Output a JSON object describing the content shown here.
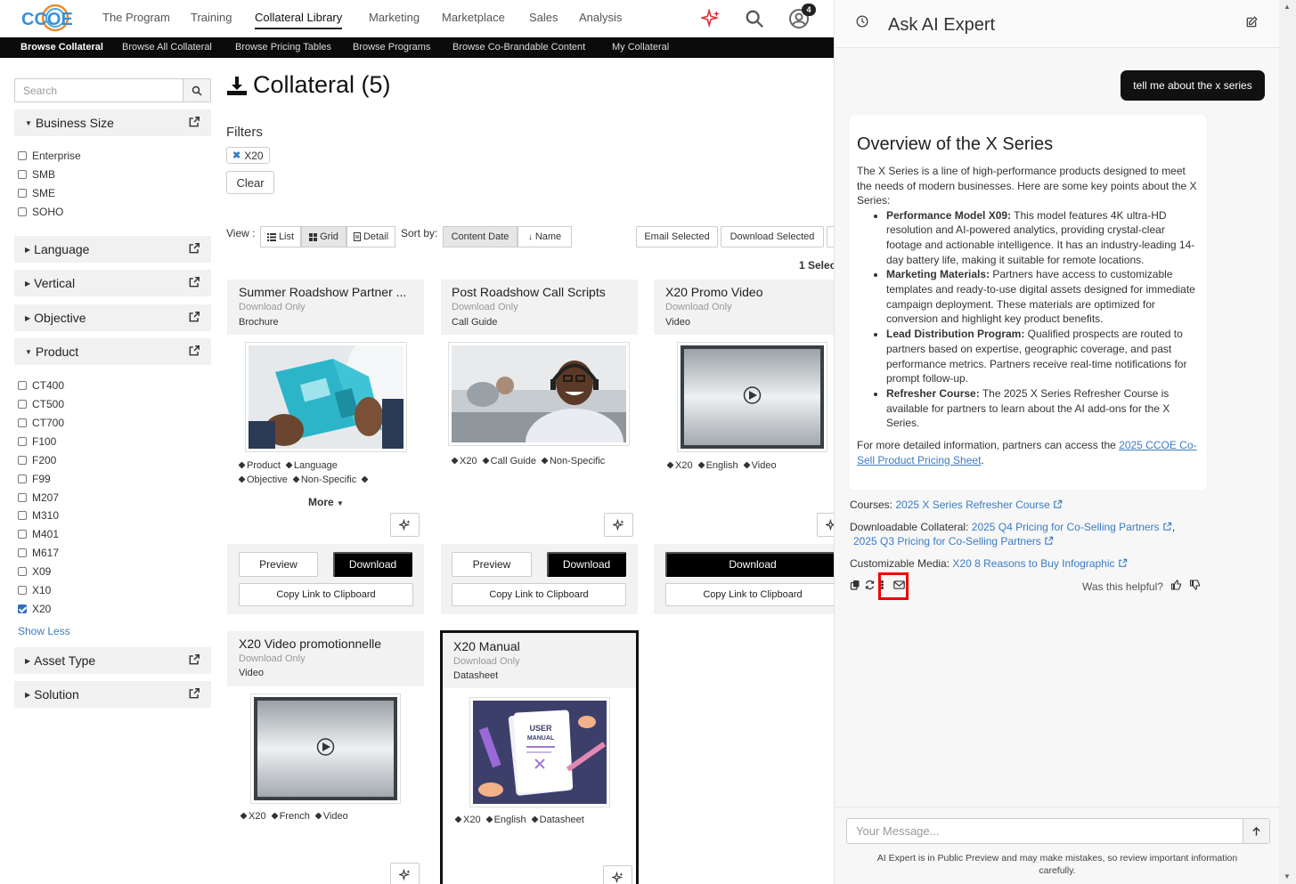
{
  "brand": {
    "logo_text": "CCOE"
  },
  "topnav": {
    "items": [
      {
        "label": "The Program"
      },
      {
        "label": "Training"
      },
      {
        "label": "Collateral Library"
      },
      {
        "label": "Marketing"
      },
      {
        "label": "Marketplace"
      },
      {
        "label": "Sales"
      },
      {
        "label": "Analysis"
      }
    ],
    "notification_count": "4",
    "active_index": 2
  },
  "subnav": {
    "items": [
      {
        "label": "Browse Collateral"
      },
      {
        "label": "Browse All Collateral"
      },
      {
        "label": "Browse Pricing Tables"
      },
      {
        "label": "Browse Programs"
      },
      {
        "label": "Browse Co-Brandable Content"
      },
      {
        "label": "My Collateral"
      }
    ]
  },
  "sidebar": {
    "search_placeholder": "Search",
    "facets": {
      "business_size": {
        "label": "Business Size",
        "options": [
          "Enterprise",
          "SMB",
          "SME",
          "SOHO"
        ]
      },
      "language": {
        "label": "Language"
      },
      "vertical": {
        "label": "Vertical"
      },
      "objective": {
        "label": "Objective"
      },
      "product": {
        "label": "Product",
        "options": [
          "CT400",
          "CT500",
          "CT700",
          "F100",
          "F200",
          "F99",
          "M207",
          "M310",
          "M401",
          "M617",
          "X09",
          "X10",
          "X20"
        ],
        "checked": "X20"
      },
      "asset_type": {
        "label": "Asset Type"
      },
      "solution": {
        "label": "Solution"
      }
    },
    "show_less": "Show Less"
  },
  "main": {
    "title": "Collateral (5)",
    "filters_label": "Filters",
    "active_filter": "X20",
    "clear_label": "Clear",
    "view_label": "View :",
    "views": [
      "List",
      "Grid",
      "Detail"
    ],
    "active_view": "Grid",
    "sort_label": "Sort by:",
    "sorts": [
      "Content Date",
      "Name"
    ],
    "email_selected": "Email Selected",
    "download_selected": "Download Selected",
    "selected_count": "1 Selec"
  },
  "cards": [
    {
      "title": "Summer Roadshow Partner ...",
      "sub": "Download Only",
      "type": "Brochure",
      "tags": [
        "Product",
        "Language",
        "Objective",
        "Non-Specific",
        ""
      ],
      "more": "More",
      "preview": "Preview",
      "download": "Download",
      "copy": "Copy Link to Clipboard"
    },
    {
      "title": "Post Roadshow Call Scripts",
      "sub": "Download Only",
      "type": "Call Guide",
      "tags": [
        "X20",
        "Call Guide",
        "Non-Specific"
      ],
      "preview": "Preview",
      "download": "Download",
      "copy": "Copy Link to Clipboard"
    },
    {
      "title": "X20 Promo Video",
      "sub": "Download Only",
      "type": "Video",
      "tags": [
        "X20",
        "English",
        "Video"
      ],
      "download": "Download",
      "copy": "Copy Link to Clipboard"
    },
    {
      "title": "X20 Video promotionnelle",
      "sub": "Download Only",
      "type": "Video",
      "tags": [
        "X20",
        "French",
        "Video"
      ]
    },
    {
      "title": "X20 Manual",
      "sub": "Download Only",
      "type": "Datasheet",
      "tags": [
        "X20",
        "English",
        "Datasheet"
      ],
      "thumb_text_1": "USER",
      "thumb_text_2": "MANUAL"
    }
  ],
  "ai": {
    "title": "Ask AI Expert",
    "user_message": "tell me about the x series",
    "response_heading": "Overview of the X Series",
    "response_intro": "The X Series is a line of high-performance products designed to meet the needs of modern businesses. Here are some key points about the X Series:",
    "bullets": [
      {
        "bold": "Performance Model X09:",
        "text": " This model features 4K ultra-HD resolution and AI-powered analytics, providing crystal-clear footage and actionable intelligence. It has an industry-leading 14-day battery life, making it suitable for remote locations."
      },
      {
        "bold": "Marketing Materials:",
        "text": " Partners have access to customizable templates and ready-to-use digital assets designed for immediate campaign deployment. These materials are optimized for conversion and highlight key product benefits."
      },
      {
        "bold": "Lead Distribution Program:",
        "text": " Qualified prospects are routed to partners based on expertise, geographic coverage, and past performance metrics. Partners receive real-time notifications for prompt follow-up."
      },
      {
        "bold": "Refresher Course:",
        "text": " The 2025 X Series Refresher Course is available for partners to learn about the AI add-ons for the X Series."
      }
    ],
    "outro": "For more detailed information, partners can access the ",
    "outro_link": "2025 CCOE Co-Sell Product Pricing Sheet",
    "outro_end": ".",
    "courses_label": "Courses:",
    "courses_link": "2025 X Series Refresher Course",
    "downloadable_label": "Downloadable Collateral:",
    "downloadable_link_1": "2025 Q4 Pricing for Co-Selling Partners",
    "downloadable_sep": ",",
    "downloadable_link_2": "2025 Q3 Pricing for Co-Selling Partners",
    "media_label": "Customizable Media:",
    "media_link": "X20 8 Reasons to Buy Infographic",
    "helpful": "Was this helpful?",
    "input_placeholder": "Your Message...",
    "disclaimer": "AI Expert is in Public Preview and may make mistakes, so review important information carefully."
  },
  "colors": {
    "accent_blue": "#3b7cc4",
    "highlight_red": "#e00000",
    "dark": "#000000",
    "sparkle_red": "#e0323c"
  }
}
